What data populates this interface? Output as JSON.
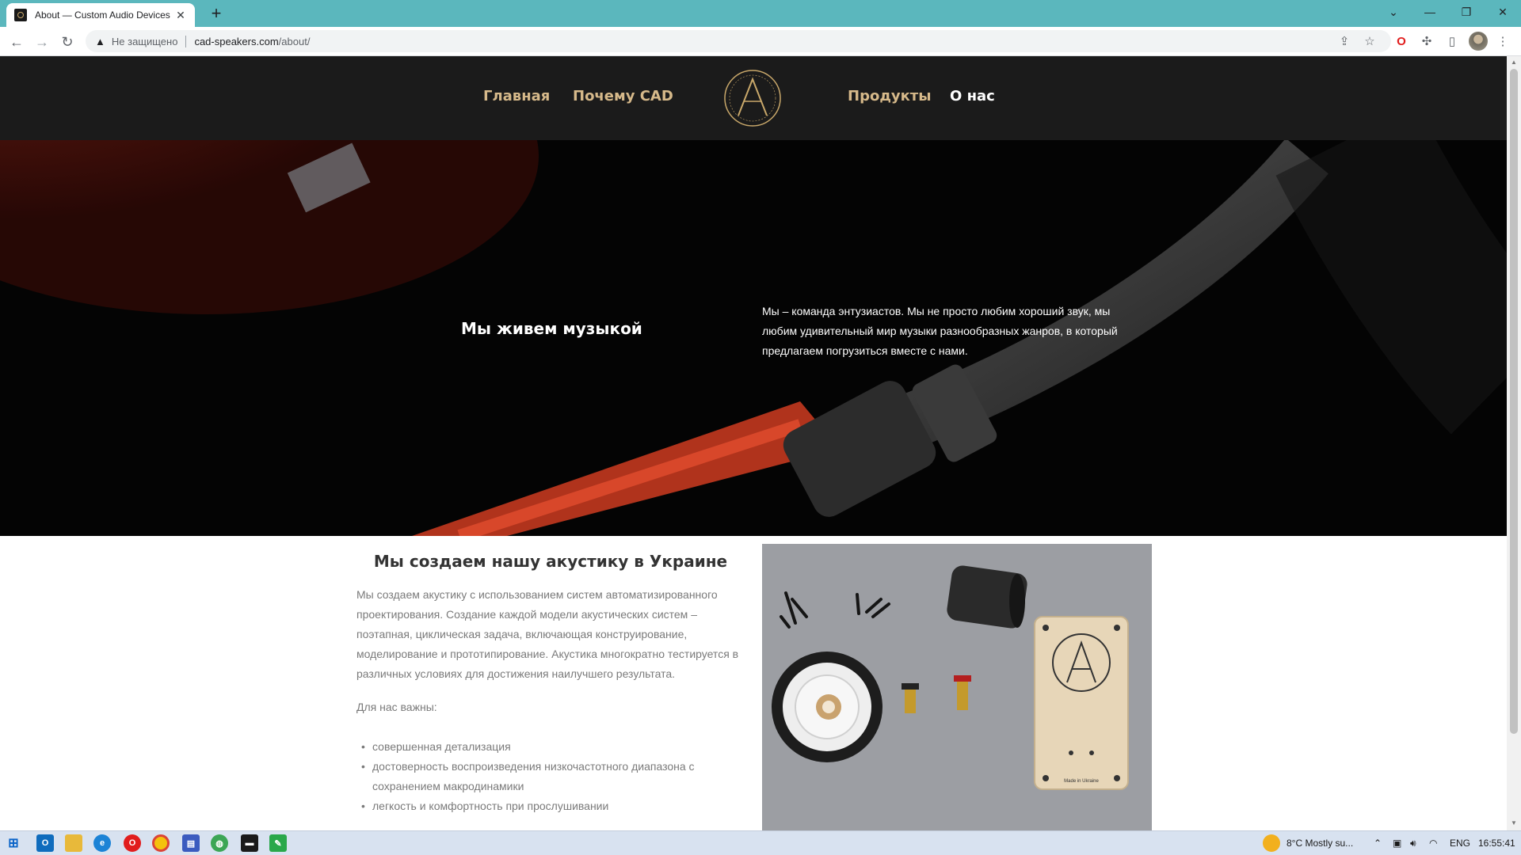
{
  "browser": {
    "tab_title": "About — Custom Audio Devices",
    "insecure_label": "Не защищено",
    "url_host": "cad-speakers.com",
    "url_path": "/about/"
  },
  "nav": {
    "home": "Главная",
    "why": "Почему CAD",
    "products": "Продукты",
    "about": "О нас"
  },
  "hero": {
    "title": "Мы живем музыкой",
    "text": "Мы – команда энтузиастов. Мы не просто любим хороший звук, мы любим удивительный мир музыки разнообразных жанров, в который предлагаем погрузиться вместе с нами."
  },
  "section": {
    "title": "Мы создаем нашу акустику в Украине",
    "body": "Мы создаем акустику с использованием систем автоматизированного проектирования. Создание каждой модели акустических систем – поэтапная, циклическая задача, включающая конструирование, моделирование и прототипирование. Акустика многократно тестируется в различных условиях для достижения наилучшего результата.",
    "important_label": "Для нас важны:",
    "bullets": [
      "совершенная  детализация",
      "достоверность воспроизведения низкочастотного диапазона с сохранением макродинамики",
      "легкость и комфортность при прослушивании"
    ],
    "photo_made_in": "Made in Ukraine"
  },
  "taskbar": {
    "weather": "8°C  Mostly su...",
    "lang": "ENG",
    "time": "16:55:41"
  },
  "colors": {
    "nav_gold": "#d6b98a",
    "header_bg": "#1b1b1b",
    "browser_accent": "#5bb7bd"
  }
}
